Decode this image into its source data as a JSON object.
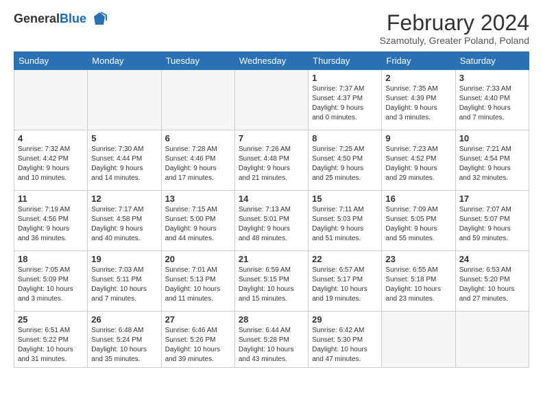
{
  "logo": {
    "general": "General",
    "blue": "Blue"
  },
  "header": {
    "title": "February 2024",
    "location": "Szamotuly, Greater Poland, Poland"
  },
  "weekdays": [
    "Sunday",
    "Monday",
    "Tuesday",
    "Wednesday",
    "Thursday",
    "Friday",
    "Saturday"
  ],
  "weeks": [
    [
      {
        "day": "",
        "info": ""
      },
      {
        "day": "",
        "info": ""
      },
      {
        "day": "",
        "info": ""
      },
      {
        "day": "",
        "info": ""
      },
      {
        "day": "1",
        "info": "Sunrise: 7:37 AM\nSunset: 4:37 PM\nDaylight: 9 hours\nand 0 minutes."
      },
      {
        "day": "2",
        "info": "Sunrise: 7:35 AM\nSunset: 4:39 PM\nDaylight: 9 hours\nand 3 minutes."
      },
      {
        "day": "3",
        "info": "Sunrise: 7:33 AM\nSunset: 4:40 PM\nDaylight: 9 hours\nand 7 minutes."
      }
    ],
    [
      {
        "day": "4",
        "info": "Sunrise: 7:32 AM\nSunset: 4:42 PM\nDaylight: 9 hours\nand 10 minutes."
      },
      {
        "day": "5",
        "info": "Sunrise: 7:30 AM\nSunset: 4:44 PM\nDaylight: 9 hours\nand 14 minutes."
      },
      {
        "day": "6",
        "info": "Sunrise: 7:28 AM\nSunset: 4:46 PM\nDaylight: 9 hours\nand 17 minutes."
      },
      {
        "day": "7",
        "info": "Sunrise: 7:26 AM\nSunset: 4:48 PM\nDaylight: 9 hours\nand 21 minutes."
      },
      {
        "day": "8",
        "info": "Sunrise: 7:25 AM\nSunset: 4:50 PM\nDaylight: 9 hours\nand 25 minutes."
      },
      {
        "day": "9",
        "info": "Sunrise: 7:23 AM\nSunset: 4:52 PM\nDaylight: 9 hours\nand 29 minutes."
      },
      {
        "day": "10",
        "info": "Sunrise: 7:21 AM\nSunset: 4:54 PM\nDaylight: 9 hours\nand 32 minutes."
      }
    ],
    [
      {
        "day": "11",
        "info": "Sunrise: 7:19 AM\nSunset: 4:56 PM\nDaylight: 9 hours\nand 36 minutes."
      },
      {
        "day": "12",
        "info": "Sunrise: 7:17 AM\nSunset: 4:58 PM\nDaylight: 9 hours\nand 40 minutes."
      },
      {
        "day": "13",
        "info": "Sunrise: 7:15 AM\nSunset: 5:00 PM\nDaylight: 9 hours\nand 44 minutes."
      },
      {
        "day": "14",
        "info": "Sunrise: 7:13 AM\nSunset: 5:01 PM\nDaylight: 9 hours\nand 48 minutes."
      },
      {
        "day": "15",
        "info": "Sunrise: 7:11 AM\nSunset: 5:03 PM\nDaylight: 9 hours\nand 51 minutes."
      },
      {
        "day": "16",
        "info": "Sunrise: 7:09 AM\nSunset: 5:05 PM\nDaylight: 9 hours\nand 55 minutes."
      },
      {
        "day": "17",
        "info": "Sunrise: 7:07 AM\nSunset: 5:07 PM\nDaylight: 9 hours\nand 59 minutes."
      }
    ],
    [
      {
        "day": "18",
        "info": "Sunrise: 7:05 AM\nSunset: 5:09 PM\nDaylight: 10 hours\nand 3 minutes."
      },
      {
        "day": "19",
        "info": "Sunrise: 7:03 AM\nSunset: 5:11 PM\nDaylight: 10 hours\nand 7 minutes."
      },
      {
        "day": "20",
        "info": "Sunrise: 7:01 AM\nSunset: 5:13 PM\nDaylight: 10 hours\nand 11 minutes."
      },
      {
        "day": "21",
        "info": "Sunrise: 6:59 AM\nSunset: 5:15 PM\nDaylight: 10 hours\nand 15 minutes."
      },
      {
        "day": "22",
        "info": "Sunrise: 6:57 AM\nSunset: 5:17 PM\nDaylight: 10 hours\nand 19 minutes."
      },
      {
        "day": "23",
        "info": "Sunrise: 6:55 AM\nSunset: 5:18 PM\nDaylight: 10 hours\nand 23 minutes."
      },
      {
        "day": "24",
        "info": "Sunrise: 6:53 AM\nSunset: 5:20 PM\nDaylight: 10 hours\nand 27 minutes."
      }
    ],
    [
      {
        "day": "25",
        "info": "Sunrise: 6:51 AM\nSunset: 5:22 PM\nDaylight: 10 hours\nand 31 minutes."
      },
      {
        "day": "26",
        "info": "Sunrise: 6:48 AM\nSunset: 5:24 PM\nDaylight: 10 hours\nand 35 minutes."
      },
      {
        "day": "27",
        "info": "Sunrise: 6:46 AM\nSunset: 5:26 PM\nDaylight: 10 hours\nand 39 minutes."
      },
      {
        "day": "28",
        "info": "Sunrise: 6:44 AM\nSunset: 5:28 PM\nDaylight: 10 hours\nand 43 minutes."
      },
      {
        "day": "29",
        "info": "Sunrise: 6:42 AM\nSunset: 5:30 PM\nDaylight: 10 hours\nand 47 minutes."
      },
      {
        "day": "",
        "info": ""
      },
      {
        "day": "",
        "info": ""
      }
    ]
  ]
}
